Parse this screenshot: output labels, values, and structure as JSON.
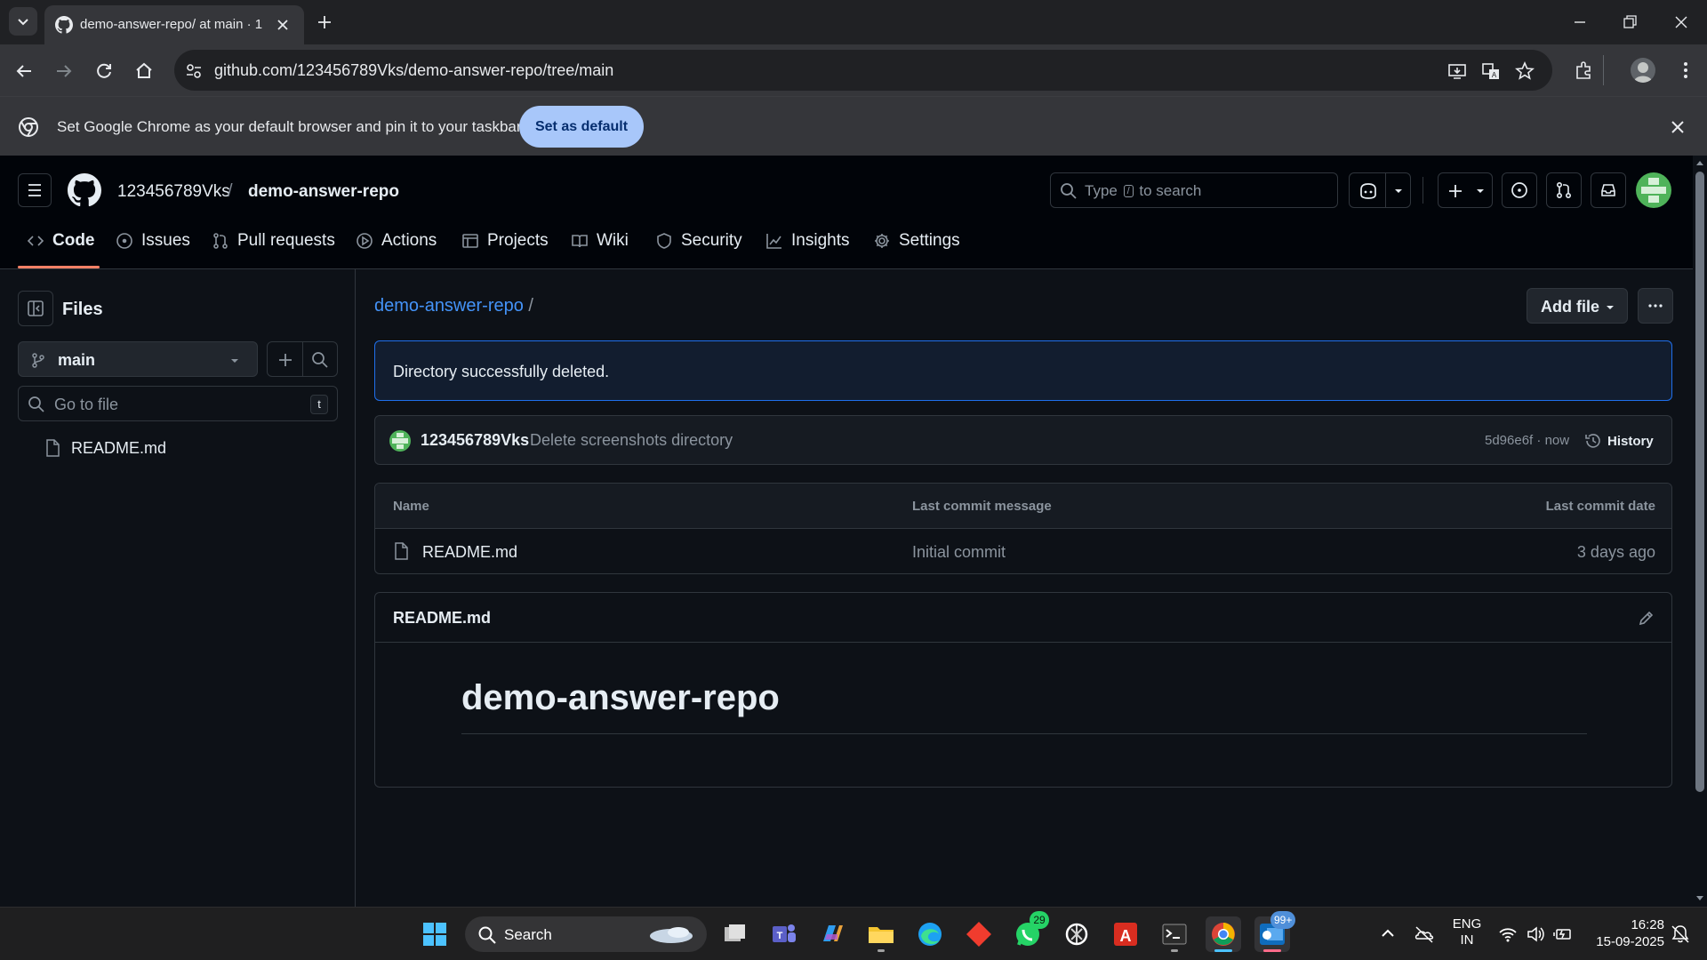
{
  "browser": {
    "tab_title": "demo-answer-repo/ at main · 1",
    "url": "github.com/123456789Vks/demo-answer-repo/tree/main",
    "infobar_message": "Set Google Chrome as your default browser and pin it to your taskbar",
    "infobar_button": "Set as default"
  },
  "header": {
    "owner": "123456789Vks",
    "separator": "/",
    "repo": "demo-answer-repo",
    "search_prefix": "Type",
    "search_key": "/",
    "search_suffix": "to search"
  },
  "tabs": [
    {
      "label": "Code",
      "icon": "code-icon",
      "active": true
    },
    {
      "label": "Issues",
      "icon": "issue-icon"
    },
    {
      "label": "Pull requests",
      "icon": "pull-request-icon"
    },
    {
      "label": "Actions",
      "icon": "play-icon"
    },
    {
      "label": "Projects",
      "icon": "table-icon"
    },
    {
      "label": "Wiki",
      "icon": "book-icon"
    },
    {
      "label": "Security",
      "icon": "shield-icon"
    },
    {
      "label": "Insights",
      "icon": "graph-icon"
    },
    {
      "label": "Settings",
      "icon": "gear-icon"
    }
  ],
  "sidebar": {
    "title": "Files",
    "branch": "main",
    "goto_placeholder": "Go to file",
    "goto_key": "t",
    "files": [
      {
        "name": "README.md",
        "icon": "file-icon"
      }
    ]
  },
  "main": {
    "breadcrumb_repo": "demo-answer-repo",
    "breadcrumb_sep": "/",
    "add_file_label": "Add file",
    "flash": "Directory successfully deleted.",
    "commit": {
      "author": "123456789Vks",
      "message": "Delete screenshots directory",
      "sha": "5d96e6f",
      "sep": "·",
      "time": "now",
      "history_label": "History"
    },
    "table": {
      "headers": [
        "Name",
        "Last commit message",
        "Last commit date"
      ],
      "rows": [
        {
          "name": "README.md",
          "message": "Initial commit",
          "date": "3 days ago"
        }
      ]
    },
    "readme": {
      "filename": "README.md",
      "heading": "demo-answer-repo"
    }
  },
  "taskbar": {
    "search_label": "Search",
    "whatsapp_badge": "29",
    "outlook_badge": "99+",
    "lang_line1": "ENG",
    "lang_line2": "IN",
    "time": "16:28",
    "date": "15-09-2025"
  },
  "colors": {
    "accent_link": "#4493f8",
    "underline": "#f78166",
    "flash_bg": "#121d2f",
    "flash_border": "#1f6feb"
  }
}
